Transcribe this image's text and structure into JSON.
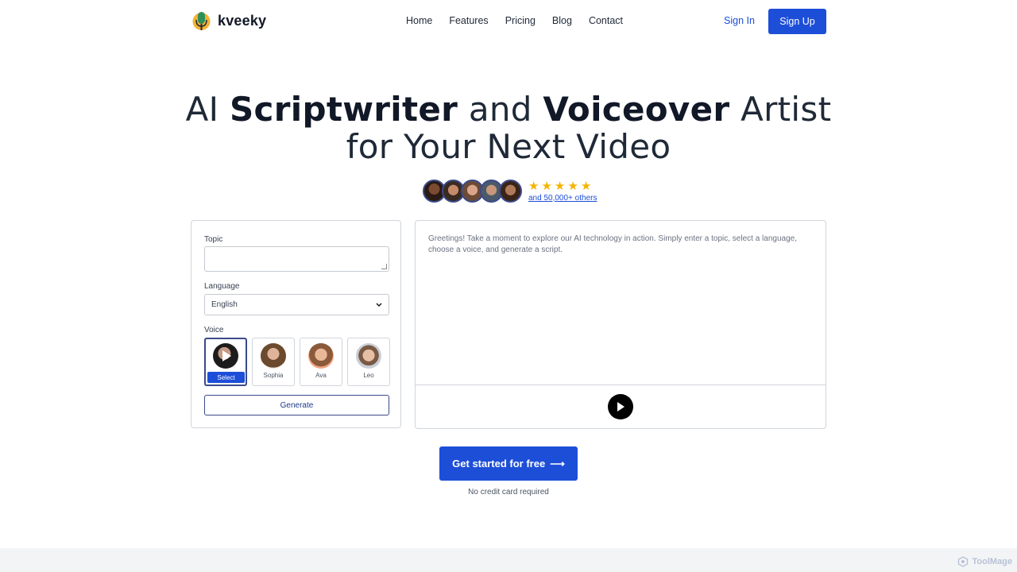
{
  "brand": {
    "name": "kveeky",
    "logo_icon": "microphone-logo"
  },
  "nav": {
    "items": [
      {
        "label": "Home"
      },
      {
        "label": "Features"
      },
      {
        "label": "Pricing"
      },
      {
        "label": "Blog"
      },
      {
        "label": "Contact"
      }
    ],
    "sign_in": "Sign In",
    "sign_up": "Sign Up"
  },
  "hero": {
    "line1_a": "AI",
    "line1_b": "Scriptwriter",
    "line1_c": "and",
    "line1_d": "Voiceover",
    "line1_e": "Artist",
    "line2": "for Your Next Video",
    "rating_stars": 5,
    "others_text": "and 50,000+ others"
  },
  "form": {
    "topic_label": "Topic",
    "topic_value": "",
    "language_label": "Language",
    "language_selected": "English",
    "voice_label": "Voice",
    "voices": [
      {
        "name": "",
        "badge": "Select",
        "selected": true
      },
      {
        "name": "Sophia"
      },
      {
        "name": "Ava"
      },
      {
        "name": "Leo"
      }
    ],
    "generate_label": "Generate"
  },
  "output": {
    "greeting": "Greetings! Take a moment to explore our AI technology in action. Simply enter a topic, select a language, choose a voice, and generate a script."
  },
  "cta": {
    "label": "Get started for free",
    "arrow": "⟶",
    "subtext": "No credit card required"
  },
  "watermark": "ToolMage",
  "colors": {
    "primary": "#1d4ed8",
    "star": "#f5b301",
    "border": "#d1d5db"
  }
}
